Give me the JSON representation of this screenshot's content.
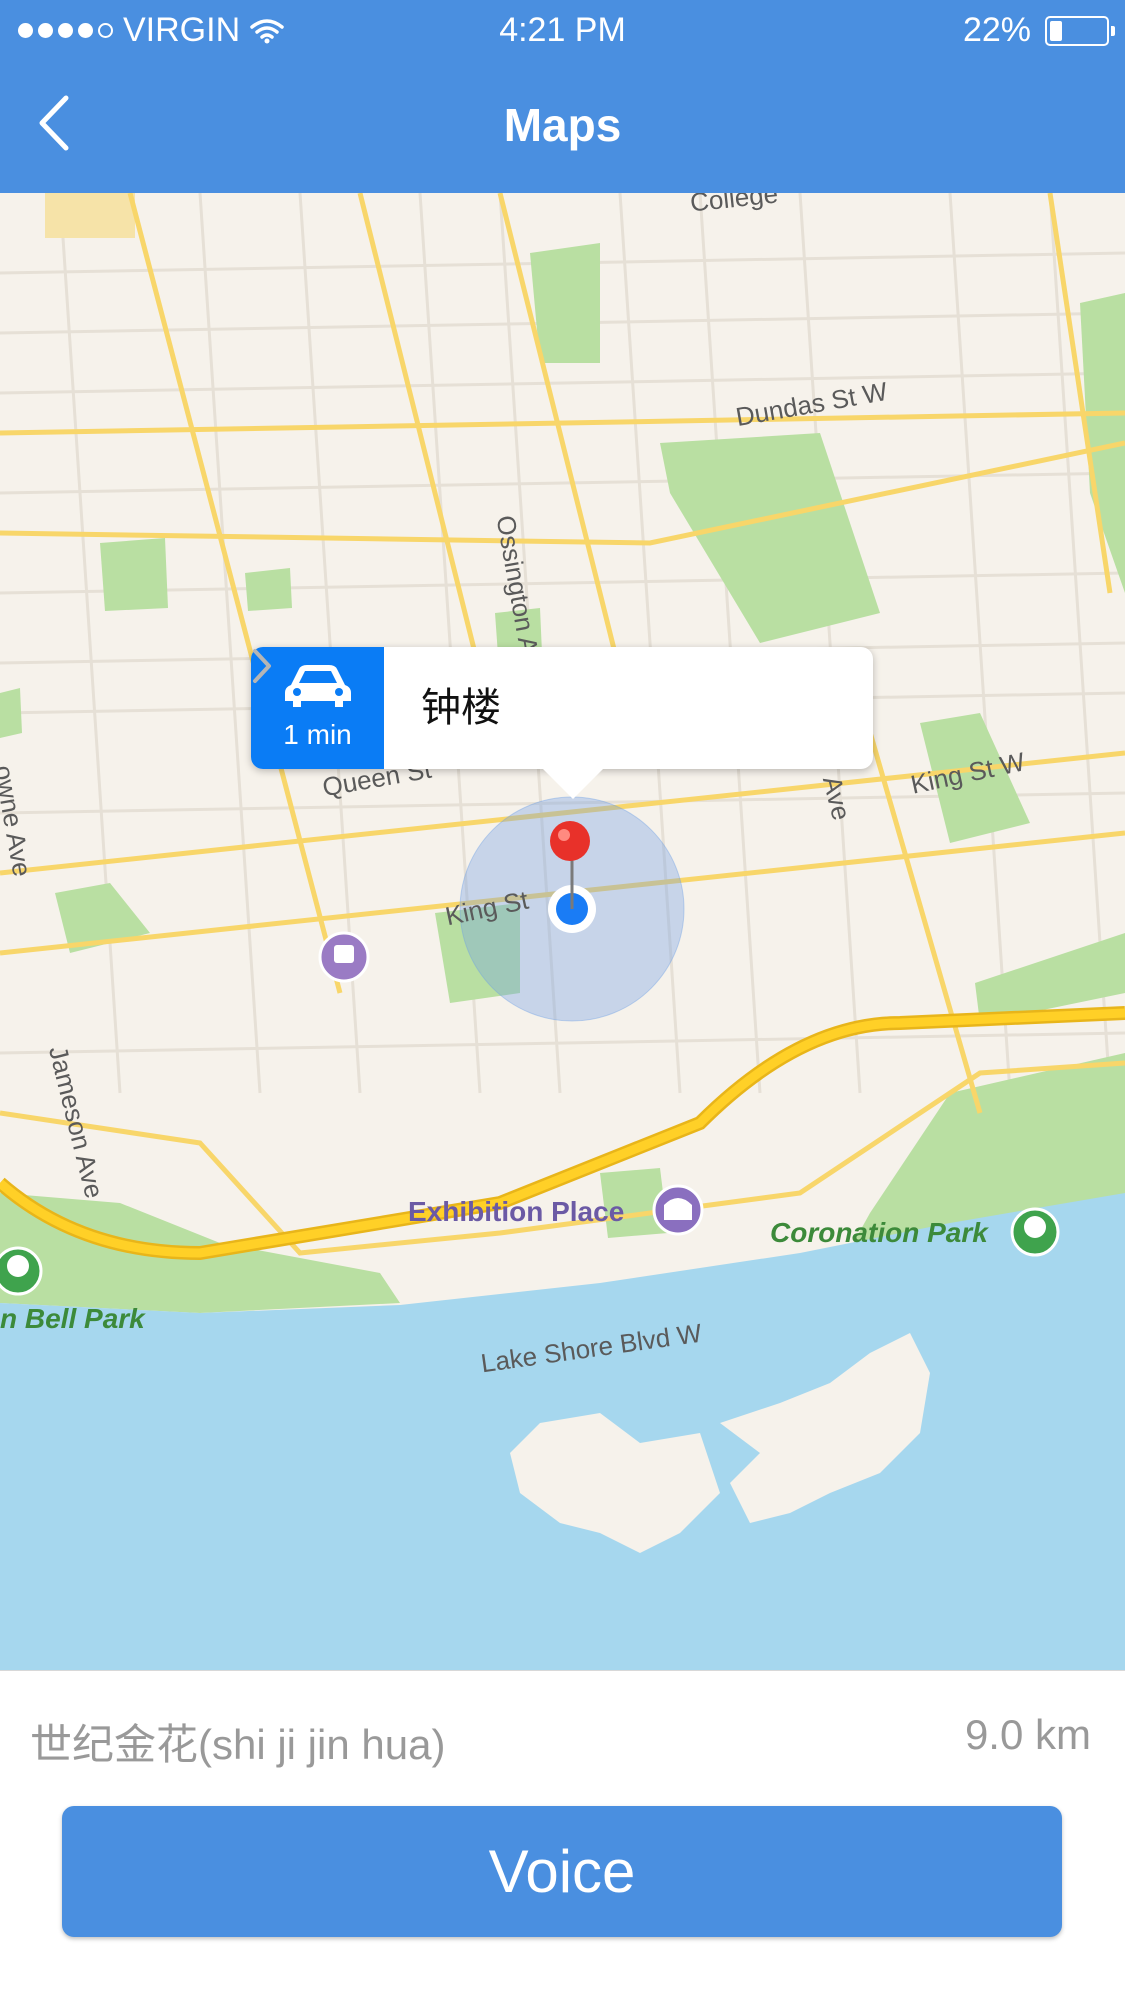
{
  "status_bar": {
    "carrier": "VIRGIN",
    "time": "4:21 PM",
    "battery_percent": "22%",
    "battery_level": 0.22,
    "signal_bars_filled": 4,
    "signal_bars_total": 5
  },
  "nav": {
    "title": "Maps",
    "back_icon": "chevron-left-icon"
  },
  "map": {
    "labels": {
      "college": "College",
      "dundas": "Dundas St W",
      "ossington": "Ossington A",
      "queen": "Queen St",
      "king_w": "King St W",
      "king": "King St",
      "ave": "Ave",
      "lowne": "owne Ave",
      "jameson": "Jameson Ave",
      "exhibition": "Exhibition Place",
      "coronation": "Coronation Park",
      "bell_park": "n Bell Park",
      "lake_shore": "Lake Shore Blvd W"
    },
    "callout": {
      "eta": "1 min",
      "title": "钟楼",
      "icon": "car-icon"
    }
  },
  "info": {
    "destination": "世纪金花(shi ji jin hua)",
    "distance": "9.0 km"
  },
  "voice_button": {
    "label": "Voice"
  },
  "colors": {
    "accent": "#4a8fe0",
    "callout_blue": "#0a7cf5",
    "water": "#a6d7ee",
    "park": "#b9dfa2",
    "major_road": "#f8c83a"
  }
}
